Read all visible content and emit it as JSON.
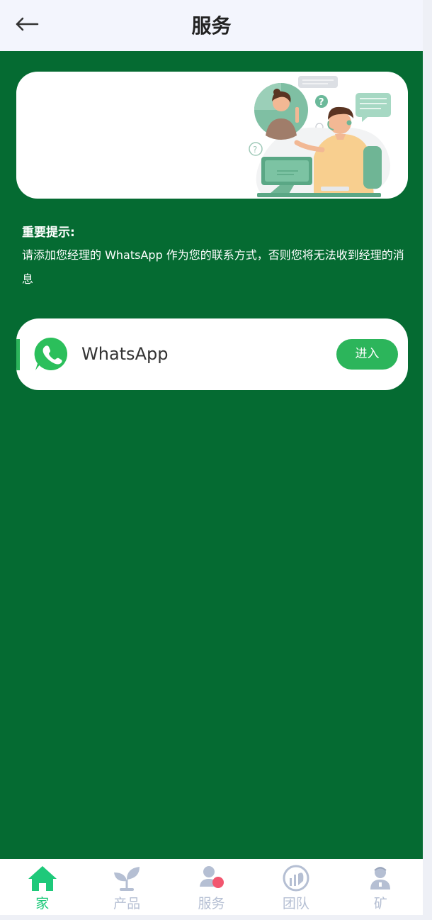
{
  "header": {
    "title": "服务",
    "back_icon": "arrow-left-icon"
  },
  "banner": {
    "illustration": "customer-support-illustration"
  },
  "notice": {
    "title": "重要提示:",
    "text": "请添加您经理的 WhatsApp 作为您的联系方式，否则您将无法收到经理的消息"
  },
  "contact": {
    "name": "WhatsApp",
    "icon": "whatsapp-icon",
    "enter_label": "进入"
  },
  "bottom_nav": {
    "items": [
      {
        "label": "家",
        "icon": "home-icon",
        "active": true
      },
      {
        "label": "产品",
        "icon": "sprout-icon",
        "active": false
      },
      {
        "label": "服务",
        "icon": "service-icon",
        "active": false
      },
      {
        "label": "团队",
        "icon": "team-icon",
        "active": false
      },
      {
        "label": "矿",
        "icon": "miner-icon",
        "active": false
      }
    ]
  },
  "colors": {
    "background": "#056b32",
    "header_bg": "#f3f5fd",
    "accent_green": "#2cb55b",
    "nav_active": "#1ec97a",
    "nav_inactive": "#b5bfd3",
    "badge_red": "#f2566f"
  }
}
